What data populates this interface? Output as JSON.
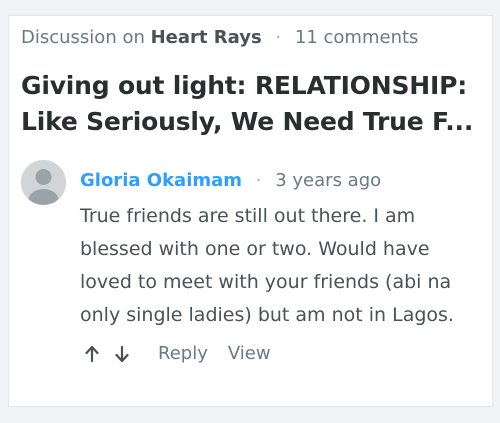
{
  "discussion": {
    "prefix": "Discussion on",
    "site_name": "Heart Rays",
    "separator": "·",
    "comment_count": "11 comments"
  },
  "post": {
    "title_line1": "Giving out light: RELATIONSHIP:",
    "title_line2": "Like Seriously, We Need True F..."
  },
  "comment": {
    "author": "Gloria Okaimam",
    "separator": "·",
    "time_ago": "3 years ago",
    "lines": [
      "True friends are still out there. I am",
      "blessed with one or two. Would have",
      "loved to meet with your friends (abi na",
      "only single ladies) but am not in Lagos."
    ],
    "actions": {
      "upvote_icon": "arrow-up-icon",
      "downvote_icon": "arrow-down-icon",
      "reply_label": "Reply",
      "view_label": "View"
    }
  },
  "colors": {
    "author_link": "#2e9fff",
    "muted_text": "#687a86",
    "body_text": "#4a5257",
    "title_text": "#2a2e2e"
  }
}
